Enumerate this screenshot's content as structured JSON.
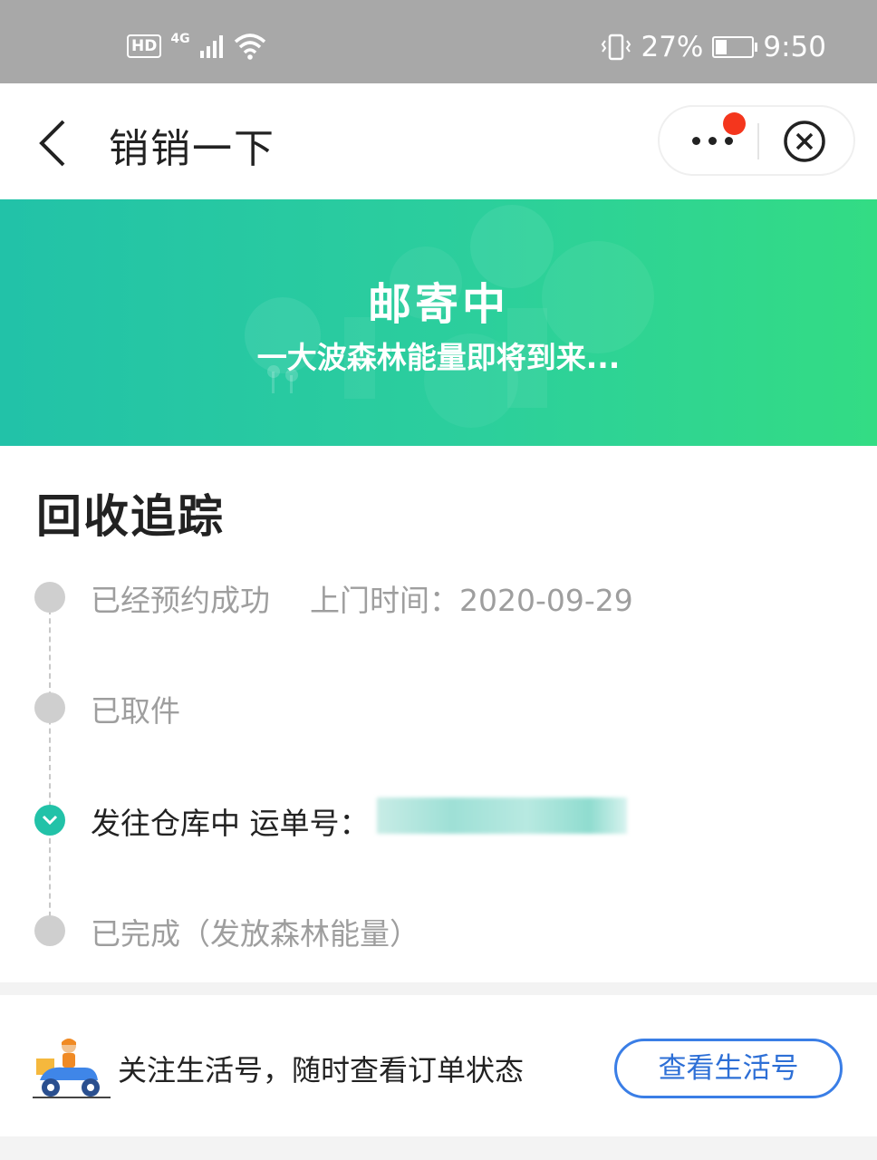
{
  "status_bar": {
    "hd": "HD",
    "network": "4G",
    "battery_percent": "27%",
    "battery_level": 0.27,
    "time": "9:50",
    "icons": [
      "hd-icon",
      "signal-icon",
      "wifi-icon",
      "vibrate-icon",
      "battery-charging-icon"
    ]
  },
  "nav": {
    "back_icon": "chevron-left-icon",
    "title": "销销一下",
    "more_icon": "more-dots-icon",
    "close_icon": "close-circle-icon",
    "has_notification_dot": true
  },
  "banner": {
    "title": "邮寄中",
    "subtitle": "一大波森林能量即将到来..."
  },
  "tracking": {
    "title": "回收追踪",
    "steps": [
      {
        "label": "已经预约成功",
        "detail": "上门时间：2020-09-29",
        "status": "done"
      },
      {
        "label": "已取件",
        "detail": "",
        "status": "done"
      },
      {
        "label": "发往仓库中 运单号：",
        "detail": "",
        "status": "current"
      },
      {
        "label": "已完成（发放森林能量）",
        "detail": "",
        "status": "pending"
      }
    ]
  },
  "footer": {
    "icon": "delivery-scooter-icon",
    "text": "关注生活号，随时查看订单状态",
    "button_label": "查看生活号"
  },
  "colors": {
    "status_bar_bg": "#a8a8a8",
    "banner_start": "#22c2a8",
    "banner_end": "#33dc84",
    "accent_blue": "#3a7ee6",
    "notification_red": "#f4361d",
    "step_active": "#22c2a8",
    "step_inactive": "#cfcfcf"
  }
}
